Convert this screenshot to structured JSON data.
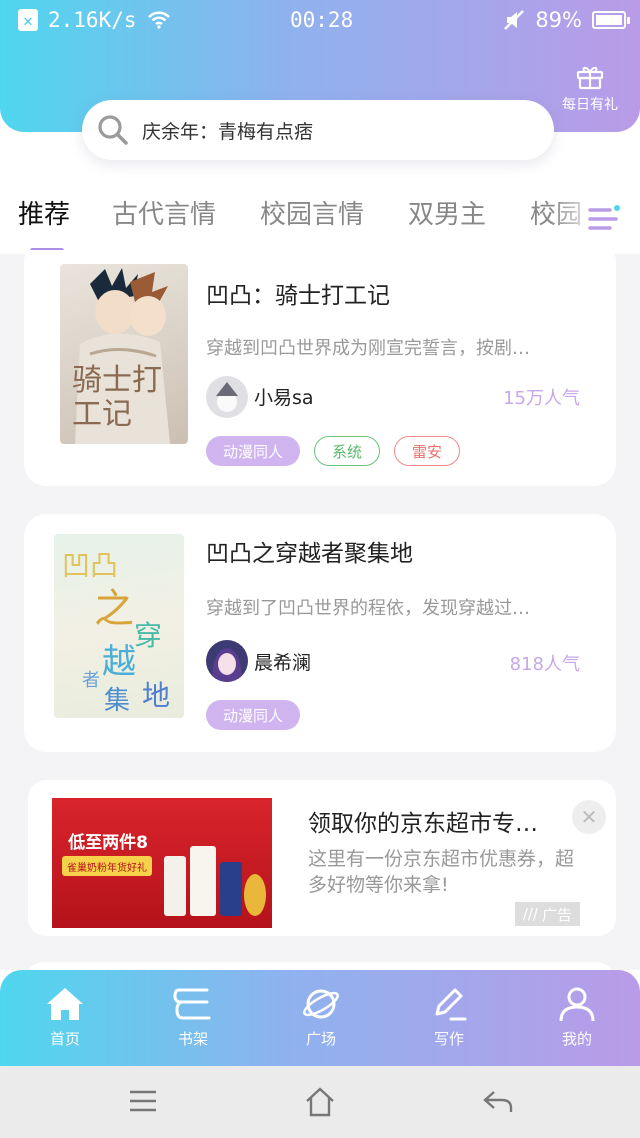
{
  "status_bar": {
    "speed": "2.16K/s",
    "time": "00:28",
    "battery": "89%"
  },
  "header": {
    "gift_label": "每日有礼"
  },
  "search": {
    "text": "庆余年：青梅有点痞"
  },
  "tabs": [
    {
      "label": "推荐"
    },
    {
      "label": "古代言情"
    },
    {
      "label": "校园言情"
    },
    {
      "label": "双男主"
    },
    {
      "label": "校园"
    }
  ],
  "books": [
    {
      "title": "凹凸：骑士打工记",
      "desc": "穿越到凹凸世界成为刚宣完誓言，按剧…",
      "author": "小易sa",
      "popularity": "15万人气",
      "tags": [
        "动漫同人",
        "系统",
        "雷安"
      ],
      "cover_text": "骑士打工记"
    },
    {
      "title": "凹凸之穿越者聚集地",
      "desc": "穿越到了凹凸世界的程依，发现穿越过…",
      "author": "晨希澜",
      "popularity": "818人气",
      "tags": [
        "动漫同人"
      ],
      "cover_text": "凹凸之穿越者聚集地"
    }
  ],
  "ad": {
    "title": "领取你的京东超市专…",
    "desc": "这里有一份京东超市优惠券，超多好物等你来拿!",
    "badge": "广告",
    "image_headline": "低至两件8折",
    "image_sub": "雀巢奶粉年货好礼"
  },
  "bottom_nav": [
    {
      "label": "首页",
      "icon": "home-icon"
    },
    {
      "label": "书架",
      "icon": "bookshelf-icon"
    },
    {
      "label": "广场",
      "icon": "planet-icon"
    },
    {
      "label": "写作",
      "icon": "pen-icon"
    },
    {
      "label": "我的",
      "icon": "user-icon"
    }
  ]
}
